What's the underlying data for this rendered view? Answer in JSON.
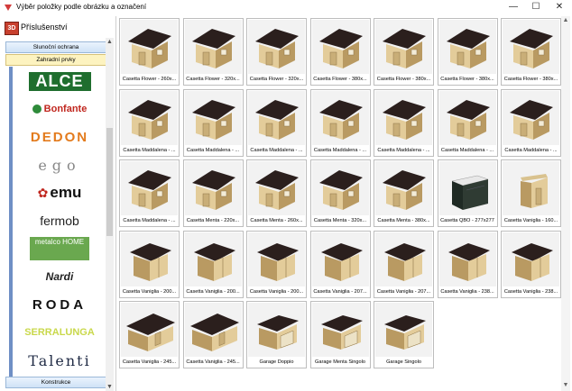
{
  "window": {
    "title": "Výběr položky podle obrázku a označení",
    "minimize": "—",
    "maximize": "☐",
    "close": "✕"
  },
  "category": {
    "icon_label": "3D",
    "title": "Příslušenství",
    "buttons": [
      "Slunoční ochrana",
      "Zahradní prvky"
    ],
    "bottom_button": "Konstrukce"
  },
  "brands": [
    {
      "name": "ALCE",
      "icon": "alce-logo"
    },
    {
      "name": "Bonfante",
      "icon": "bonfante-logo"
    },
    {
      "name": "DEDON",
      "icon": "dedon-logo"
    },
    {
      "name": "ego",
      "icon": "ego-logo"
    },
    {
      "name": "emu",
      "icon": "emu-logo"
    },
    {
      "name": "fermob",
      "icon": "fermob-logo"
    },
    {
      "name": "metalco HOME",
      "icon": "metalco-logo"
    },
    {
      "name": "Nardi",
      "icon": "nardi-logo"
    },
    {
      "name": "RODA",
      "icon": "roda-logo"
    },
    {
      "name": "SERRALUNGA",
      "icon": "serralunga-logo"
    },
    {
      "name": "Talenti",
      "icon": "talenti-logo"
    }
  ],
  "items": [
    {
      "label": "Casetta Flower - 260x...",
      "kind": "flower"
    },
    {
      "label": "Casetta Flower - 320x...",
      "kind": "flower"
    },
    {
      "label": "Casetta Flower - 320x...",
      "kind": "flower"
    },
    {
      "label": "Casetta Flower - 380x...",
      "kind": "flower"
    },
    {
      "label": "Casetta Flower - 380x...",
      "kind": "flower"
    },
    {
      "label": "Casetta Flower - 380x...",
      "kind": "flower"
    },
    {
      "label": "Casetta Flower - 380x...",
      "kind": "flower"
    },
    {
      "label": "Casetta Maddalena - ...",
      "kind": "hip"
    },
    {
      "label": "Casetta Maddalena - ...",
      "kind": "hip"
    },
    {
      "label": "Casetta Maddalena - ...",
      "kind": "hip"
    },
    {
      "label": "Casetta Maddalena - ...",
      "kind": "hip"
    },
    {
      "label": "Casetta Maddalena - ...",
      "kind": "hip"
    },
    {
      "label": "Casetta Maddalena - ...",
      "kind": "hip"
    },
    {
      "label": "Casetta Maddalena - ...",
      "kind": "hip"
    },
    {
      "label": "Casetta Maddalena - ...",
      "kind": "hip"
    },
    {
      "label": "Casetta Menta - 220x...",
      "kind": "menta"
    },
    {
      "label": "Casetta Menta - 260x...",
      "kind": "menta"
    },
    {
      "label": "Casetta Menta - 320x...",
      "kind": "menta"
    },
    {
      "label": "Casetta Menta - 380x...",
      "kind": "menta"
    },
    {
      "label": "Casetta QBO - 277x277",
      "kind": "qbo"
    },
    {
      "label": "Casetta Vaniglia - 160...",
      "kind": "mono"
    },
    {
      "label": "Casetta Vaniglia - 200...",
      "kind": "vaniglia"
    },
    {
      "label": "Casetta Vaniglia - 200...",
      "kind": "vaniglia"
    },
    {
      "label": "Casetta Vaniglia - 200...",
      "kind": "vaniglia"
    },
    {
      "label": "Casetta Vaniglia - 207...",
      "kind": "vaniglia"
    },
    {
      "label": "Casetta Vaniglia - 207...",
      "kind": "vaniglia"
    },
    {
      "label": "Casetta Vaniglia - 238...",
      "kind": "vaniglia"
    },
    {
      "label": "Casetta Vaniglia - 238...",
      "kind": "vaniglia"
    },
    {
      "label": "Casetta Vaniglia - 245...",
      "kind": "long"
    },
    {
      "label": "Casetta Vaniglia - 245...",
      "kind": "long"
    },
    {
      "label": "Garage Doppio",
      "kind": "garage"
    },
    {
      "label": "Garage Menta Singolo",
      "kind": "garage"
    },
    {
      "label": "Garage Singolo",
      "kind": "garage"
    }
  ],
  "colors": {
    "wood": "#e3cc9a",
    "wood_dark": "#b99a62",
    "roof": "#2b1f1d",
    "qbo": "#1f2a24"
  }
}
